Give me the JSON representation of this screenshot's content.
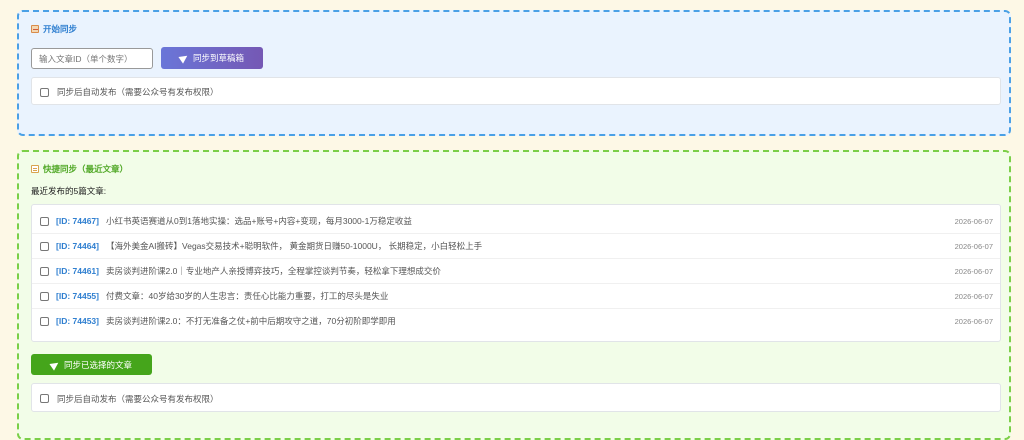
{
  "sync_panel": {
    "title": "开始同步",
    "input_placeholder": "输入文章ID（单个数字）",
    "sync_button": "同步到草稿箱",
    "auto_publish_label": "同步后自动发布（需要公众号有发布权限）",
    "auto_publish_checked": false
  },
  "quick_panel": {
    "title": "快捷同步（最近文章）",
    "recent_label": "最近发布的5篇文章:",
    "articles": [
      {
        "id": "[ID: 74467]",
        "title": "小红书英语赛道从0到1落地实操：选品+账号+内容+变现，每月3000-1万稳定收益",
        "date": "2026-06-07",
        "checked": false
      },
      {
        "id": "[ID: 74464]",
        "title": "【海外美金AI搬砖】Vegas交易技术+聪明软件， 黄金期货日赚50-1000U， 长期稳定，小白轻松上手",
        "date": "2026-06-07",
        "checked": false
      },
      {
        "id": "[ID: 74461]",
        "title": "卖房谈判进阶课2.0｜专业地产人亲授博弈技巧，全程掌控谈判节奏，轻松拿下理想成交价",
        "date": "2026-06-07",
        "checked": false
      },
      {
        "id": "[ID: 74455]",
        "title": "付费文章：40岁给30岁的人生忠言：责任心比能力重要，打工的尽头是失业",
        "date": "2026-06-07",
        "checked": false
      },
      {
        "id": "[ID: 74453]",
        "title": "卖房谈判进阶课2.0：不打无准备之仗+前中后期攻守之道，70分初阶即学即用",
        "date": "2026-06-07",
        "checked": false
      }
    ],
    "sync_selected_button": "同步已选择的文章",
    "auto_publish_label": "同步后自动发布（需要公众号有发布权限）",
    "auto_publish_checked": false
  },
  "colors": {
    "page_bg": "#fdf8e6",
    "sync_panel_bg": "#eaf3fe",
    "sync_panel_border": "#4aa0e6",
    "quick_panel_bg": "#f2fde8",
    "quick_panel_border": "#7bcf48",
    "id_link": "#2f7fd0",
    "draft_button": "#7065c8",
    "selected_button": "#45a51b"
  },
  "icons": {
    "sync_title": "pencil-icon",
    "quick_title": "document-icon",
    "buttons": "send-icon"
  }
}
